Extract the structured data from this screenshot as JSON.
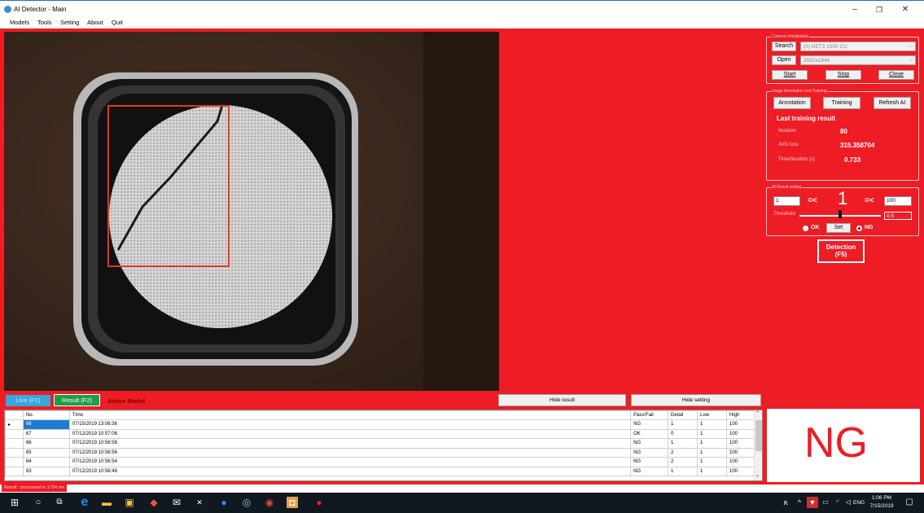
{
  "window": {
    "title": "AI Detector - Main",
    "minimize": "–",
    "maximize": "❐",
    "close": "✕"
  },
  "menu": [
    "Models",
    "Tools",
    "Setting",
    "About",
    "Quit"
  ],
  "camera": {
    "section_title": "Camera Initialization",
    "search_label": "Search",
    "device": "(0) NET3 1500 CU",
    "open_label": "Open",
    "resolution": "2592x1944",
    "start_label": "Start",
    "stop_label": "Stop",
    "close_label": "Close"
  },
  "training": {
    "section_title": "Image Annotation and Training",
    "annotation_label": "Annotation",
    "training_label": "Training",
    "refresh_label": "Refresh AI",
    "last_result_title": "Last training result",
    "iteration_label": "Iteration",
    "iteration_value": "80",
    "avg_loss_label": "AVG loss",
    "avg_loss_value": "315.358704",
    "time_label": "Time/Iteration (s)",
    "time_value": "0.733"
  },
  "ai_result": {
    "section_title": "AI Result setting",
    "min_value": "1",
    "op1": "=<",
    "current": "1",
    "op2": "=<",
    "max_value": "100",
    "threshold_label": "Threshold",
    "threshold_value": "0.5",
    "threshold_level": 0.5,
    "ok_label": "OK",
    "set_label": "Set",
    "ng_label": "NG",
    "selected": "NG"
  },
  "detection": {
    "label_line1": "Detection",
    "label_line2": "(F5)"
  },
  "bottom_bar": {
    "live_label": "Live (F1)",
    "result_label": "Result (F2)",
    "active_model": "Active Model",
    "hide_result": "Hide result",
    "hide_setting": "Hide setting"
  },
  "grid": {
    "headers": [
      "No.",
      "Time",
      "Pass/Fail",
      "Detail",
      "Low",
      "High"
    ],
    "rows": [
      [
        "68",
        "07/15/2019 13:06:36",
        "NG",
        "1",
        "1",
        "100"
      ],
      [
        "67",
        "07/12/2019 10:57:06",
        "OK",
        "0",
        "1",
        "100"
      ],
      [
        "66",
        "07/12/2019 10:56:58",
        "NG",
        "1",
        "1",
        "100"
      ],
      [
        "65",
        "07/12/2019 10:56:56",
        "NG",
        "2",
        "1",
        "100"
      ],
      [
        "64",
        "07/12/2019 10:56:54",
        "NG",
        "2",
        "1",
        "100"
      ],
      [
        "63",
        "07/12/2019 10:56:48",
        "NG",
        "1",
        "1",
        "100"
      ]
    ]
  },
  "verdict": {
    "text": "NG",
    "color": "#ee1c25"
  },
  "status_text": "Result : processed in 1724 ms",
  "taskbar": {
    "lang": "ENG",
    "time": "1:06 PM",
    "date": "7/15/2019"
  },
  "colors": {
    "accent_red": "#ee1c25",
    "selection_blue": "#1f7bd2",
    "live_btn": "#36a8dc",
    "result_btn": "#1e9c4a"
  }
}
